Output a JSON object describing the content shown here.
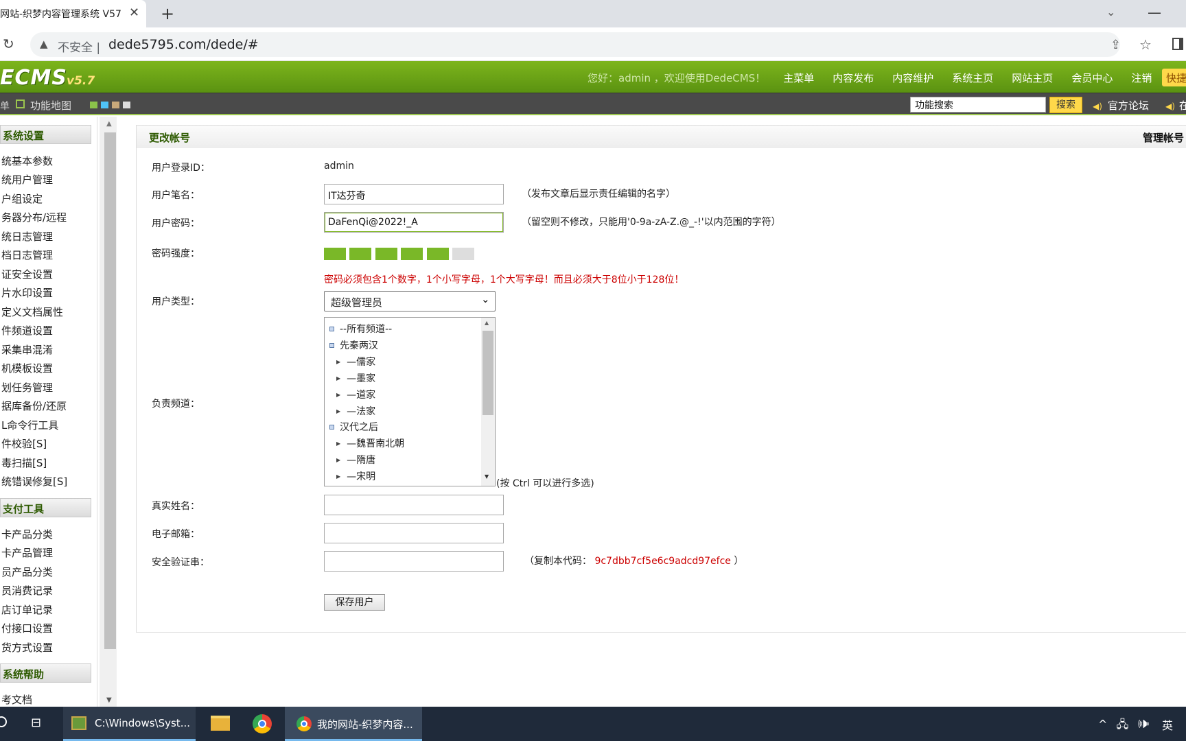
{
  "browser": {
    "tab_title": "网站-织梦内容管理系统 V57",
    "tab_close": "✕",
    "new_tab": "+",
    "insecure_label": "不安全 |",
    "url": "dede5795.com/dede/#"
  },
  "header": {
    "logo": "ECMS",
    "logo_version": "v5.7",
    "greeting": "您好：admin ，欢迎使用DedeCMS！",
    "nav": [
      "主菜单",
      "内容发布",
      "内容维护",
      "系统主页",
      "网站主页",
      "会员中心",
      "注销"
    ],
    "quick_button": "快捷"
  },
  "toolbar": {
    "left_fragment": "单",
    "map_label": "功能地图",
    "swatch_colors": [
      "#8bc34a",
      "#4fc3f7",
      "#c8a97a",
      "#dddddd"
    ],
    "search_value": "功能搜索",
    "search_button": "搜索",
    "forum_link": "官方论坛",
    "online_link": "在"
  },
  "sidebar": {
    "sections": [
      {
        "title": "系统设置",
        "items": [
          "统基本参数",
          "统用户管理",
          "户组设定",
          "务器分布/远程",
          "统日志管理",
          "档日志管理",
          "证安全设置",
          "片水印设置",
          "定义文档属性",
          "件频道设置",
          "采集串混淆",
          "机模板设置",
          "划任务管理",
          "据库备份/还原",
          "L命令行工具",
          "件校验[S]",
          "毒扫描[S]",
          "统错误修复[S]"
        ]
      },
      {
        "title": "支付工具",
        "items": [
          "卡产品分类",
          "卡产品管理",
          "员产品分类",
          "员消费记录",
          "店订单记录",
          "付接口设置",
          "货方式设置"
        ]
      },
      {
        "title": "系统帮助",
        "items": [
          "考文档"
        ]
      }
    ]
  },
  "form": {
    "title": "更改帐号",
    "manage_link": "管理帐号",
    "login_id_label": "用户登录ID：",
    "login_id_value": "admin",
    "penname_label": "用户笔名：",
    "penname_value": "IT达芬奇",
    "penname_note": "（发布文章后显示责任编辑的名字）",
    "password_label": "用户密码：",
    "password_value": "DaFenQi@2022!_A",
    "password_note": "（留空则不修改，只能用'0-9a-zA-Z.@_-!'以内范围的字符）",
    "strength_label": "密码强度：",
    "strength_level": 5,
    "strength_max": 6,
    "password_rule": "密码必须包含1个数字，1个小写字母，1个大写字母！而且必须大于8位小于128位！",
    "usertype_label": "用户类型：",
    "usertype_value": "超级管理员",
    "channel_label": "负责频道：",
    "channels": [
      {
        "label": "--所有频道--",
        "level": 0
      },
      {
        "label": "先秦两汉",
        "level": 0
      },
      {
        "label": "—儒家",
        "level": 1
      },
      {
        "label": "—墨家",
        "level": 1
      },
      {
        "label": "—道家",
        "level": 1
      },
      {
        "label": "—法家",
        "level": 1
      },
      {
        "label": "汉代之后",
        "level": 0
      },
      {
        "label": "—魏晋南北朝",
        "level": 1
      },
      {
        "label": "—隋唐",
        "level": 1
      },
      {
        "label": "—宋明",
        "level": 1
      }
    ],
    "channel_note": "(按 Ctrl 可以进行多选)",
    "realname_label": "真实姓名：",
    "realname_value": "",
    "email_label": "电子邮箱：",
    "email_value": "",
    "safecode_label": "安全验证串：",
    "safecode_value": "",
    "safecode_note_prefix": "（复制本代码：",
    "safecode_code": "9c7dbb7cf5e6c9adcd97efce",
    "safecode_note_suffix": "）",
    "save_button": "保存用户"
  },
  "taskbar": {
    "cmd_label": "C:\\Windows\\Syst...",
    "active_label": "我的网站-织梦内容...",
    "tray": "^ 🖧 🕪",
    "ime": "英"
  }
}
